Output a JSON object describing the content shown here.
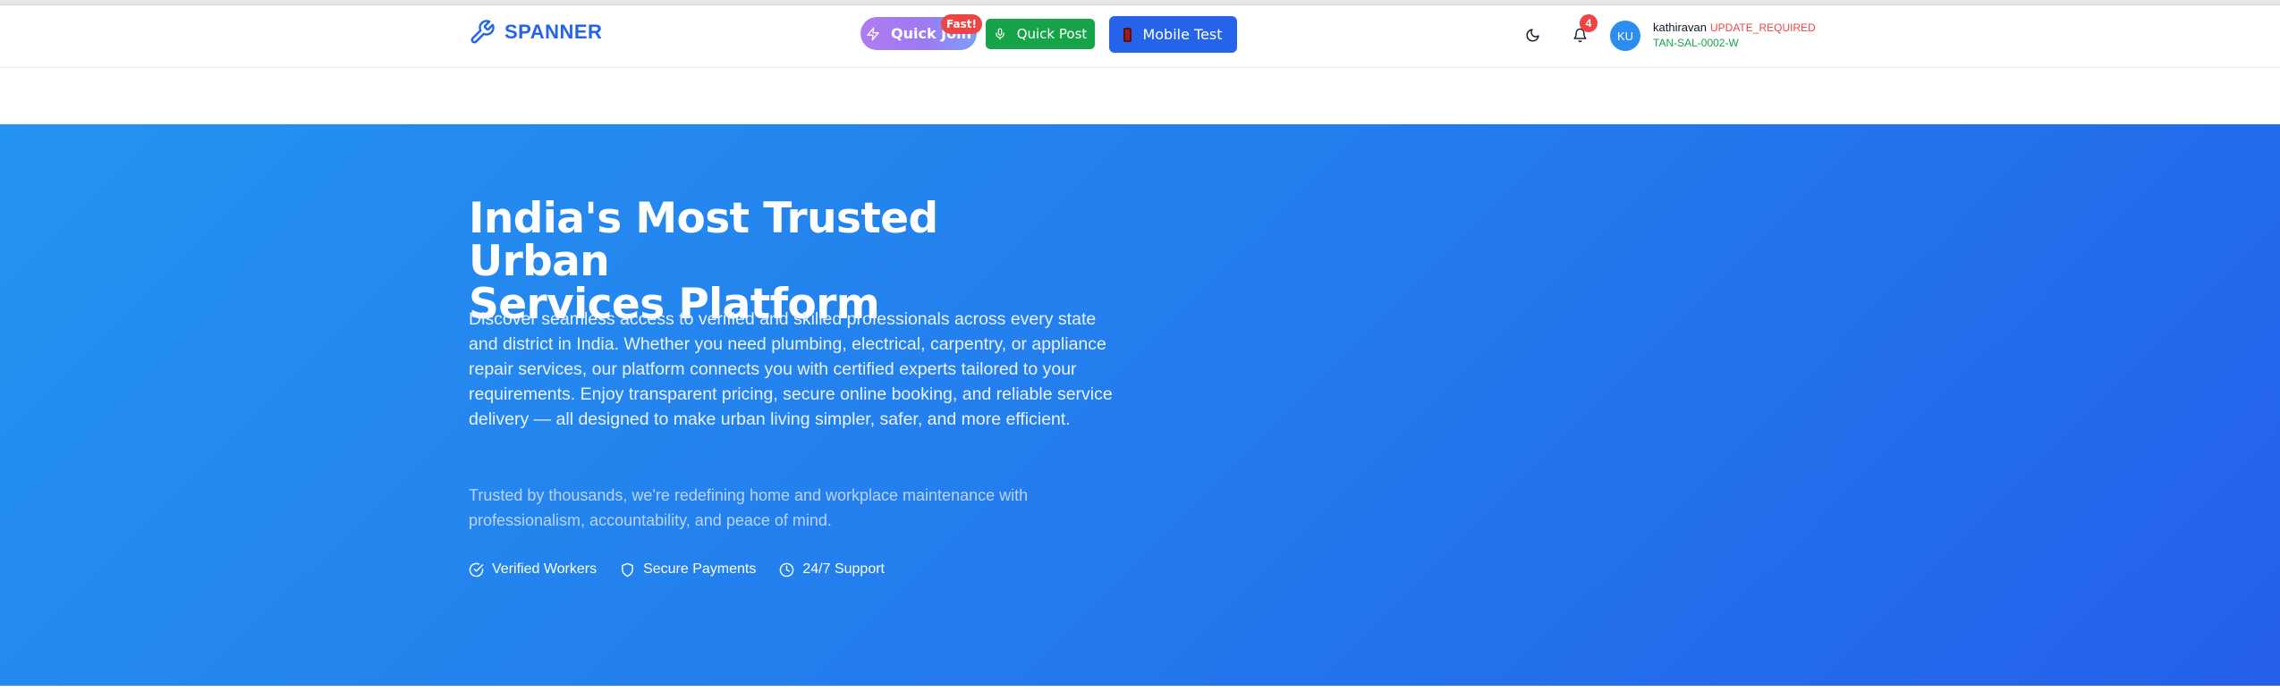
{
  "brand": {
    "name": "SPANNER",
    "icon": "wrench-icon",
    "color": "#2563eb"
  },
  "nav": {
    "quick_join": {
      "label": "Quick Join",
      "badge": "Fast!",
      "icon": "zap-icon"
    },
    "quick_post": {
      "label": "Quick Post",
      "icon": "mic-icon"
    },
    "mobile_test": {
      "label": "Mobile Test",
      "icon": "phone-icon"
    },
    "theme_toggle": {
      "icon": "moon-icon"
    },
    "notifications": {
      "icon": "bell-icon",
      "count": "4"
    }
  },
  "user": {
    "initials": "KU",
    "name": "kathiravan",
    "status": "UPDATE_REQUIRED",
    "code": "TAN-SAL-0002-W"
  },
  "hero": {
    "title_line1": "India's Most Trusted Urban",
    "title_line2": "Services Platform",
    "description": "Discover seamless access to verified and skilled professionals across every state and district in India. Whether you need plumbing, electrical, carpentry, or appliance repair services, our platform connects you with certified experts tailored to your requirements. Enjoy transparent pricing, secure online booking, and reliable service delivery — all designed to make urban living simpler, safer, and more efficient.",
    "subtext": "Trusted by thousands, we're redefining home and workplace maintenance with professionalism, accountability, and peace of mind.",
    "features": [
      {
        "label": "Verified Workers",
        "icon": "check-circle-icon"
      },
      {
        "label": "Secure Payments",
        "icon": "shield-icon"
      },
      {
        "label": "24/7 Support",
        "icon": "clock-icon"
      }
    ]
  },
  "colors": {
    "hero_start": "#2593f0",
    "hero_end": "#2560eb",
    "quick_post_green": "#16a34a",
    "mobile_test_blue": "#2563eb",
    "badge_red": "#ef4444"
  }
}
